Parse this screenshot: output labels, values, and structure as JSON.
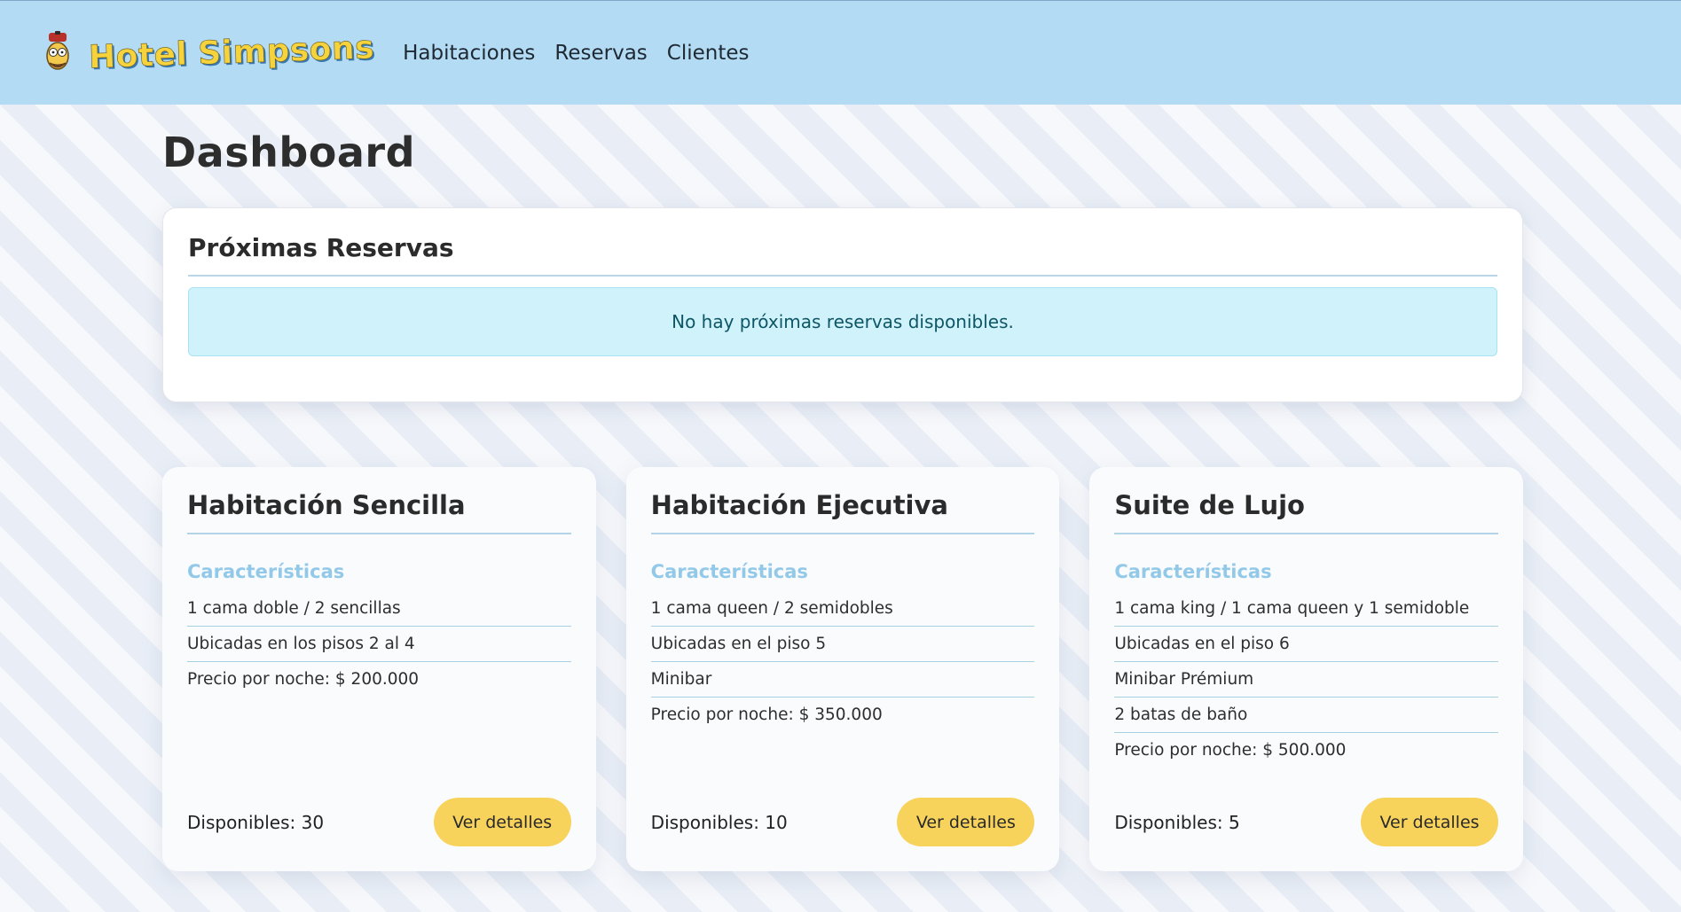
{
  "navbar": {
    "brand_hotel": "Hotel",
    "brand_simpsons": "Simpsons",
    "links": [
      {
        "label": "Habitaciones"
      },
      {
        "label": "Reservas"
      },
      {
        "label": "Clientes"
      }
    ]
  },
  "page": {
    "title": "Dashboard"
  },
  "upcoming": {
    "title": "Próximas Reservas",
    "empty_message": "No hay próximas reservas disponibles."
  },
  "rooms": [
    {
      "title": "Habitación Sencilla",
      "features_heading": "Características",
      "features": [
        "1 cama doble / 2 sencillas",
        "Ubicadas en los pisos 2 al 4",
        "Precio por noche: $ 200.000"
      ],
      "available": "Disponibles: 30",
      "button": "Ver detalles"
    },
    {
      "title": "Habitación Ejecutiva",
      "features_heading": "Características",
      "features": [
        "1 cama queen / 2 semidobles",
        "Ubicadas en el piso 5",
        "Minibar",
        "Precio por noche: $ 350.000"
      ],
      "available": "Disponibles: 10",
      "button": "Ver detalles"
    },
    {
      "title": "Suite de Lujo",
      "features_heading": "Características",
      "features": [
        "1 cama king / 1 cama queen y 1 semidoble",
        "Ubicadas en el piso 6",
        "Minibar Prémium",
        "2 batas de baño",
        "Precio por noche: $ 500.000"
      ],
      "available": "Disponibles: 5",
      "button": "Ver detalles"
    }
  ],
  "colors": {
    "navbar_bg": "#b3dbf4",
    "accent_yellow": "#f8d35c",
    "features_heading": "#93c9e8",
    "alert_bg": "#d0f2fb"
  },
  "icons": {
    "brand": "homer-face-icon"
  }
}
